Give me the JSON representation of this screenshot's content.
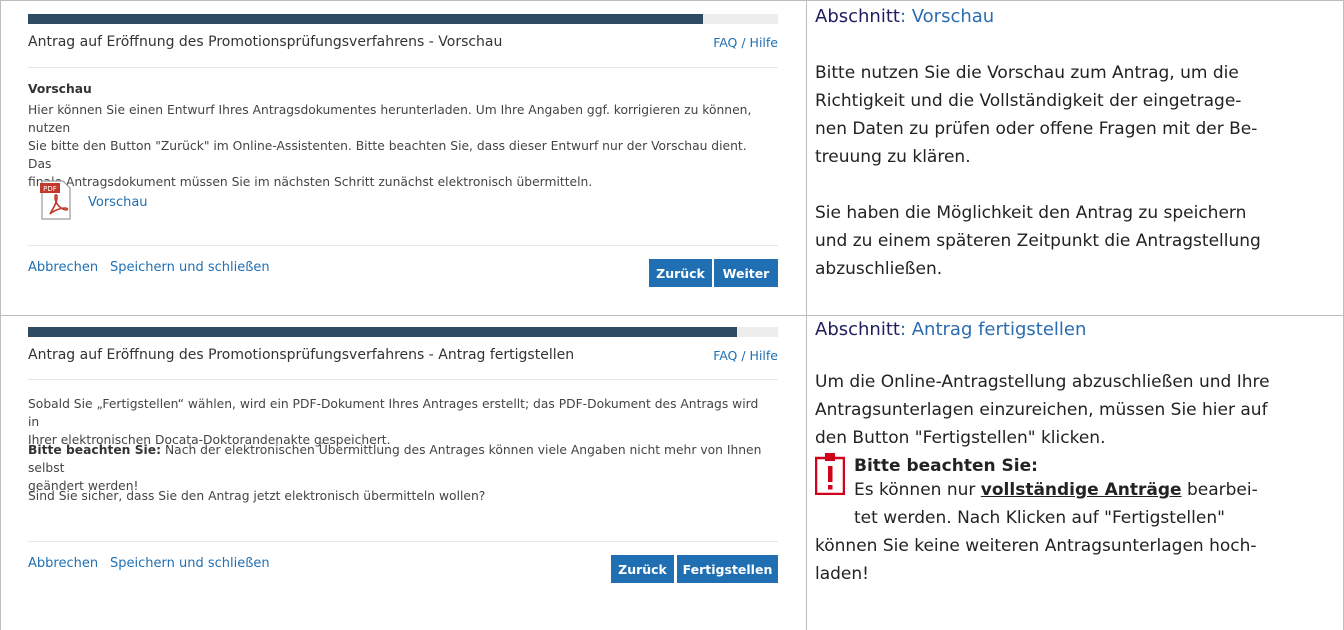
{
  "top": {
    "panel": {
      "progress": 0.9,
      "title": "Antrag auf Eröffnung des Promotionsprüfungsverfahrens - Vorschau",
      "faq": "FAQ / Hilfe",
      "section_label": "Vorschau",
      "text_lines": [
        "Hier können Sie einen Entwurf Ihres Antragsdokumentes herunterladen. Um Ihre Angaben ggf. korrigieren zu können, nutzen",
        "Sie bitte den Button \"Zurück\" im Online-Assistenten. Bitte beachten Sie, dass dieser Entwurf nur der Vorschau dient. Das",
        "finale Antragsdokument müssen Sie im nächsten Schritt zunächst elektronisch übermitteln."
      ],
      "pdf_icon_label": "PDF",
      "pdf_link": "Vorschau",
      "cancel": "Abbrechen",
      "save_close": "Speichern und schließen",
      "back": "Zurück",
      "next": "Weiter"
    },
    "side": {
      "title_kw": "Abschnitt",
      "title_rest": ": Vorschau",
      "p1_lines": [
        "Bitte nutzen Sie die Vorschau zum Antrag, um die",
        "Richtigkeit und die Vollständigkeit der eingetrage-",
        "nen Daten zu prüfen oder offene Fragen mit der Be-",
        "treuung zu klären."
      ],
      "p2_lines": [
        "Sie haben die Möglichkeit den Antrag zu speichern",
        "und zu einem späteren Zeitpunkt die Antragstellung",
        "abzuschließen."
      ]
    }
  },
  "bottom": {
    "panel": {
      "progress": 0.945,
      "title": "Antrag auf Eröffnung des Promotionsprüfungsverfahrens - Antrag fertigstellen",
      "faq": "FAQ / Hilfe",
      "p1_lines": [
        "Sobald Sie „Fertigstellen“ wählen, wird ein PDF-Dokument Ihres Antrages erstellt; das PDF-Dokument des Antrags wird in",
        "Ihrer elektronischen Docata-Doktorandenakte gespeichert."
      ],
      "p2_bold": "Bitte beachten Sie:",
      "p2_line1_rest": " Nach der elektronischen Übermittlung des Antrages können viele Angaben nicht mehr von Ihnen selbst",
      "p2_line2": "geändert werden!",
      "p3": "Sind Sie sicher, dass Sie den Antrag jetzt elektronisch übermitteln wollen?",
      "cancel": "Abbrechen",
      "save_close": "Speichern und schließen",
      "back": "Zurück",
      "finish": "Fertigstellen"
    },
    "side": {
      "title_kw": "Abschnitt",
      "title_rest": ": Antrag fertigstellen",
      "p1_lines": [
        "Um die Online-Antragstellung abzuschließen und Ihre",
        "Antragsunterlagen einzureichen, müssen Sie hier auf",
        "den Button \"Fertigstellen\" klicken."
      ],
      "warn_head": "Bitte beachten Sie:",
      "warn_l1_pre": "Es können nur ",
      "warn_l1_u": "vollständige Anträge",
      "warn_l1_post": " bearbei-",
      "warn_l2": "tet werden. Nach Klicken auf \"Fertigstellen\"",
      "warn_l3": "können Sie keine weiteren Antragsunterlagen hoch-",
      "warn_l4": "laden!"
    }
  },
  "colors": {
    "progress": "#2e4b61",
    "link": "#1f6fb2",
    "button": "#1f6fb2",
    "warning": "#d0021b"
  }
}
